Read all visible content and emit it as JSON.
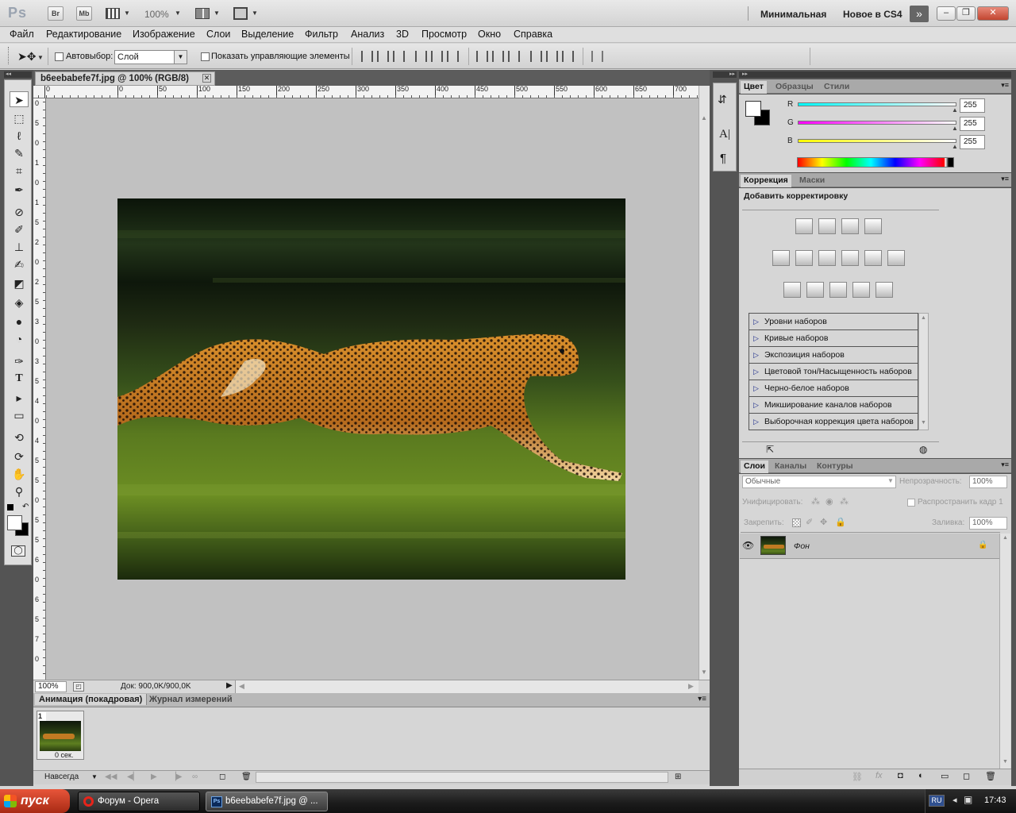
{
  "app": {
    "logo": "Ps",
    "bridge": "Br",
    "minibridge": "Mb",
    "zoom": "100%",
    "workspace_1": "Минимальная",
    "workspace_2": "Новое в CS4",
    "win_minimize": "–",
    "win_restore": "❐",
    "win_close": "✕"
  },
  "menu": [
    "Файл",
    "Редактирование",
    "Изображение",
    "Слои",
    "Выделение",
    "Фильтр",
    "Анализ",
    "3D",
    "Просмотр",
    "Окно",
    "Справка"
  ],
  "options": {
    "autoselect_label": "Автовыбор:",
    "autoselect_value": "Слой",
    "show_controls_label": "Показать управляющие элементы"
  },
  "document": {
    "tab_title": "b6eebabefe7f.jpg @ 100% (RGB/8)",
    "ruler_top_ticks": [
      "0",
      "0",
      "50",
      "100",
      "150",
      "200",
      "250",
      "300",
      "350",
      "400",
      "450",
      "500",
      "550",
      "600",
      "650",
      "700"
    ],
    "ruler_left_ticks": [
      "0",
      "5",
      "0",
      "1",
      "0",
      "1",
      "5",
      "2",
      "0",
      "2",
      "5",
      "3",
      "0",
      "3",
      "5",
      "4",
      "0",
      "4",
      "5",
      "5",
      "0",
      "5",
      "5",
      "6",
      "0",
      "6",
      "5",
      "7",
      "0"
    ],
    "status_zoom": "100%",
    "status_doc": "Док: 900,0K/900,0K"
  },
  "animation": {
    "tab_active": "Анимация (покадровая)",
    "tab_other": "Журнал измерений",
    "frame_number": "1",
    "frame_delay": "0 сек.",
    "loop": "Навсегда"
  },
  "color_panel": {
    "tabs": [
      "Цвет",
      "Образцы",
      "Стили"
    ],
    "r_label": "R",
    "g_label": "G",
    "b_label": "B",
    "r": "255",
    "g": "255",
    "b": "255"
  },
  "adjust_panel": {
    "tabs": [
      "Коррекция",
      "Маски"
    ],
    "title": "Добавить корректировку",
    "presets": [
      "Уровни наборов",
      "Кривые наборов",
      "Экспозиция наборов",
      "Цветовой тон/Насыщенность наборов",
      "Черно-белое наборов",
      "Микширование каналов наборов",
      "Выборочная коррекция цвета наборов"
    ]
  },
  "layers_panel": {
    "tabs": [
      "Слои",
      "Каналы",
      "Контуры"
    ],
    "blend_mode": "Обычные",
    "opacity_label": "Непрозрачность:",
    "opacity": "100%",
    "unify_label": "Унифицировать:",
    "propagate_label": "Распространить кадр 1",
    "lock_label": "Закрепить:",
    "fill_label": "Заливка:",
    "fill": "100%",
    "layer_name": "Фон"
  },
  "taskbar": {
    "start": "пуск",
    "task1": "Форум - Opera",
    "task2": "b6eebabefe7f.jpg @ ...",
    "lang": "RU",
    "time": "17:43"
  }
}
